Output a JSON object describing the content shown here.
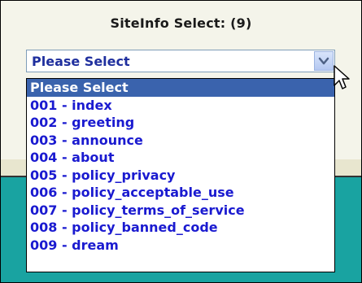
{
  "title": "SiteInfo Select: (9)",
  "select": {
    "current_value": "Please Select"
  },
  "dropdown": {
    "options": [
      {
        "label": "Please Select",
        "selected": true
      },
      {
        "label": "001 - index",
        "selected": false
      },
      {
        "label": "002 - greeting",
        "selected": false
      },
      {
        "label": "003 - announce",
        "selected": false
      },
      {
        "label": "004 - about",
        "selected": false
      },
      {
        "label": "005 - policy_privacy",
        "selected": false
      },
      {
        "label": "006 - policy_acceptable_use",
        "selected": false
      },
      {
        "label": "007 - policy_terms_of_service",
        "selected": false
      },
      {
        "label": "008 - policy_banned_code",
        "selected": false
      },
      {
        "label": "009 - dream",
        "selected": false
      }
    ]
  },
  "icons": {
    "select_arrow": "chevron-down-icon",
    "pointer": "mouse-pointer-icon"
  },
  "colors": {
    "option_text": "#1a1ad0",
    "selected_bg": "#3a63ad",
    "teal_band": "#19a3a1",
    "panel_bg": "#f4f4ea"
  }
}
